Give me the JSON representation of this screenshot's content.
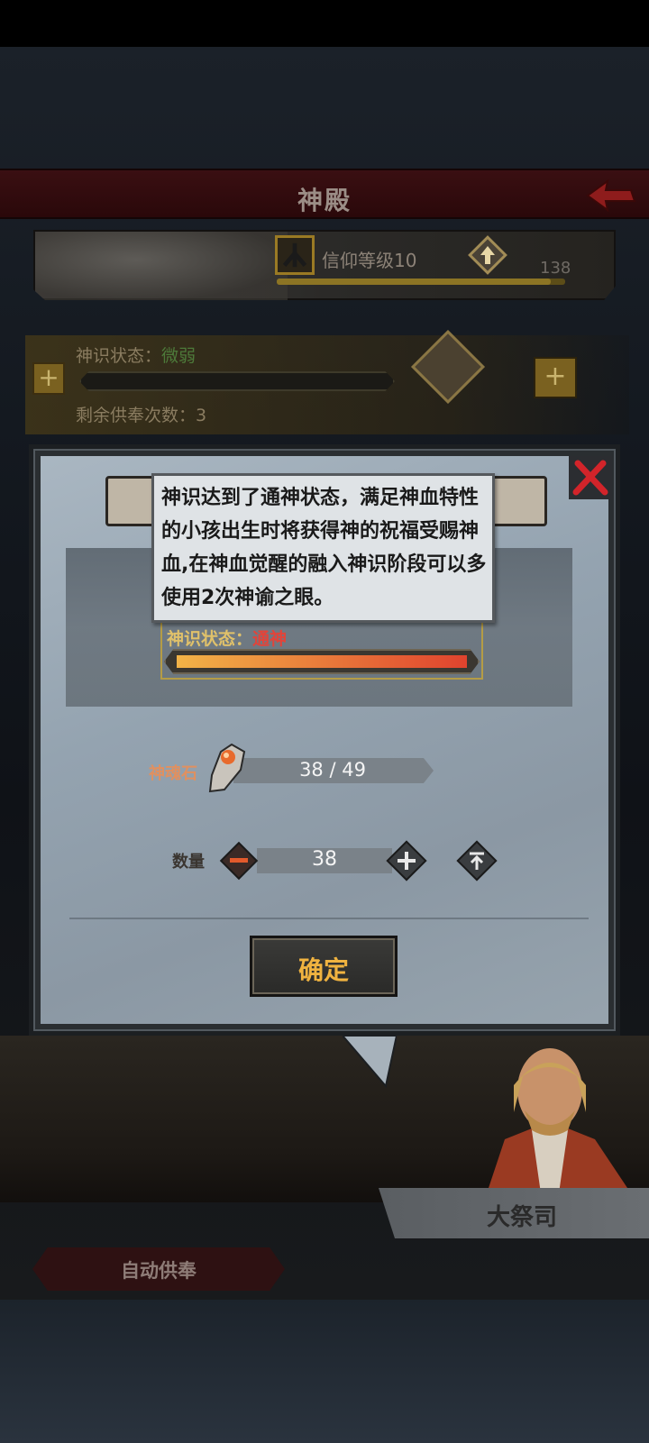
{
  "header": {
    "title": "神殿"
  },
  "faith": {
    "level_label": "信仰等级10",
    "value": "138",
    "progress": 0.95
  },
  "divine": {
    "status_prefix": "神识状态：",
    "status_value": "微弱",
    "remaining_label": "剩余供奉次数：3"
  },
  "dialog": {
    "tooltip": "神识达到了通神状态，满足神血特性的小孩出生时将获得神的祝福受赐神血,在神血觉醒的融入神识阶段可以多使用2次神谕之眼。",
    "state_prefix": "神识状态：",
    "state_value": "通神",
    "state_progress": 1.0,
    "stone_label": "神魂石",
    "stone_count": "38 / 49",
    "qty_label": "数量",
    "qty_value": "38",
    "confirm_label": "确定"
  },
  "npc": {
    "name": "大祭司"
  },
  "footer": {
    "auto_offer_label": "自动供奉"
  },
  "colors": {
    "accent": "#f0b340",
    "danger": "#e2443a",
    "header": "#3a0f12"
  }
}
